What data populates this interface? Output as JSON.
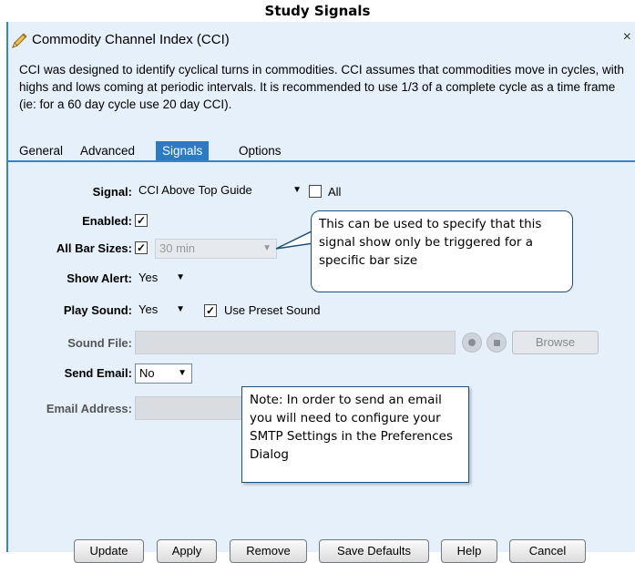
{
  "page_title": "Study Signals",
  "dialog": {
    "title": "Commodity Channel Index (CCI)",
    "close": "×",
    "description": "CCI was designed to identify cyclical turns in commodities. CCI assumes that commodities move in cycles, with highs and lows coming at periodic intervals. It is recommended to use 1/3 of a complete cycle as a time frame (ie: for a 60 day cycle use 20 day CCI).",
    "accent_color": "#2a7ac4"
  },
  "tabs": [
    {
      "label": "General",
      "active": false
    },
    {
      "label": "Advanced",
      "active": false
    },
    {
      "label": "Signals",
      "active": true
    },
    {
      "label": "Options",
      "active": false
    }
  ],
  "form": {
    "signal_label": "Signal:",
    "signal_value": "CCI Above Top Guide",
    "all_label": "All",
    "all_checked": false,
    "enabled_label": "Enabled:",
    "enabled_checked": true,
    "all_bar_sizes_label": "All Bar Sizes:",
    "all_bar_sizes_checked": true,
    "bar_size_value": "30 min",
    "show_alert_label": "Show Alert:",
    "show_alert_value": "Yes",
    "play_sound_label": "Play Sound:",
    "play_sound_value": "Yes",
    "use_preset_label": "Use Preset Sound",
    "use_preset_checked": true,
    "sound_file_label": "Sound File:",
    "sound_file_value": "",
    "browse_label": "Browse",
    "send_email_label": "Send Email:",
    "send_email_value": "No",
    "email_address_label": "Email Address:",
    "email_address_value": "",
    "check_mark": "✓",
    "dropdown_arrow": "▼"
  },
  "buttons": {
    "update": "Update",
    "apply": "Apply",
    "remove": "Remove",
    "save_defaults": "Save Defaults",
    "help": "Help",
    "cancel": "Cancel"
  },
  "callouts": {
    "bar_size": "This can be used to specify that this signal show only be triggered for a specific bar size",
    "email": "Note: In order to send an email you will need to configure your SMTP Settings in the Preferences Dialog"
  },
  "icons": {
    "title_icon": "pencil-icon",
    "play": "play-icon",
    "stop": "stop-icon"
  }
}
